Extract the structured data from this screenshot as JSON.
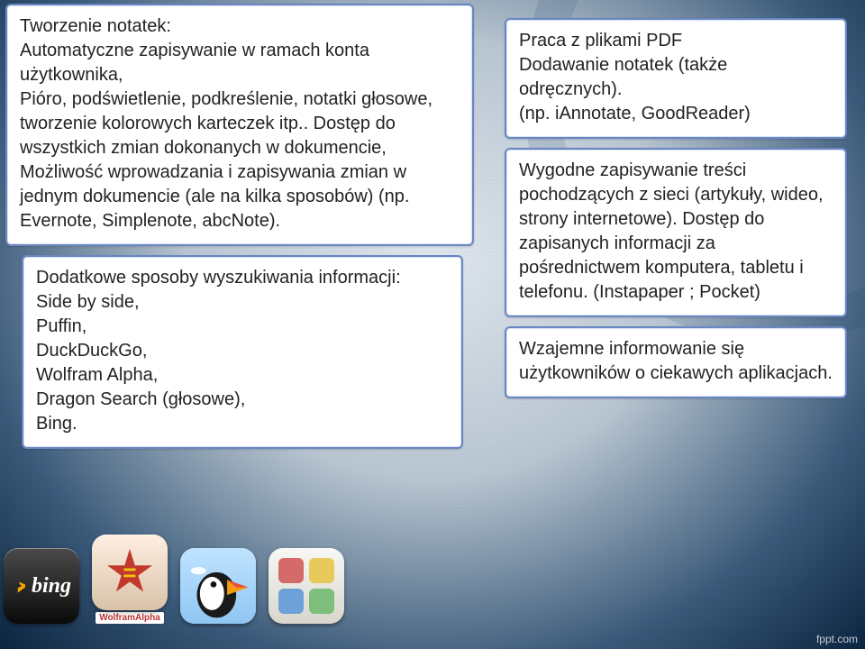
{
  "left": {
    "box1": "Tworzenie notatek:\nAutomatyczne zapisywanie w ramach konta użytkownika,\nPióro, podświetlenie, podkreślenie, notatki głosowe, tworzenie kolorowych karteczek itp.. Dostęp do wszystkich zmian dokonanych w dokumencie,\nMożliwość wprowadzania i zapisywania zmian w jednym dokumencie (ale na kilka sposobów) (np. Evernote, Simplenote, abcNote).",
    "box2": "Dodatkowe sposoby wyszukiwania informacji:\nSide by side,\nPuffin,\nDuckDuckGo,\nWolfram Alpha,\nDragon Search (głosowe),\nBing."
  },
  "right": {
    "box3": "Praca z plikami PDF\nDodawanie notatek (także odręcznych).\n(np. iAnnotate, GoodReader)",
    "box4": "Wygodne zapisywanie treści pochodzących z sieci (artykuły, wideo, strony internetowe). Dostęp do zapisanych informacji za pośrednictwem komputera, tabletu i telefonu. (Instapaper ; Pocket)",
    "box5": "Wzajemne informowanie się użytkowników o ciekawych aplikacjach."
  },
  "icons": {
    "bing": "bing",
    "wolfram_label": "WolframAlpha"
  },
  "footer": "fppt.com"
}
